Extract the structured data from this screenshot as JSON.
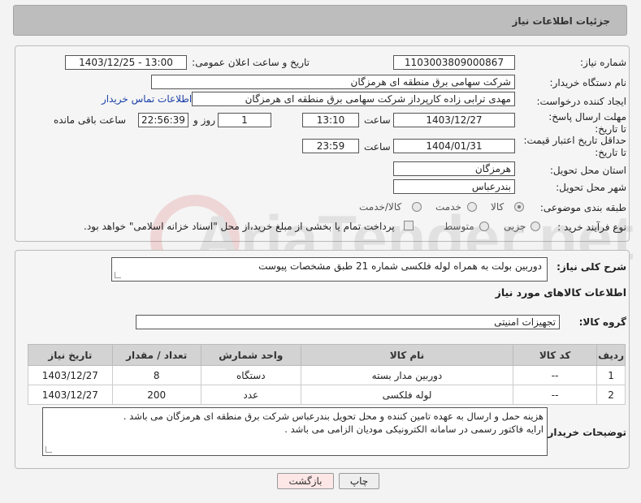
{
  "header": {
    "title": "جزئیات اطلاعات نیاز"
  },
  "form": {
    "need_number_label": "شماره نیاز:",
    "need_number": "1103003809000867",
    "announce_label": "تاریخ و ساعت اعلان عمومی:",
    "announce_value": "1403/12/25 - 13:00",
    "buyer_label": "نام دستگاه خریدار:",
    "buyer_value": "شرکت سهامی برق منطقه ای هرمزگان",
    "creator_label": "ایجاد کننده درخواست:",
    "creator_value": "مهدی ترابی زاده کارپرداز شرکت سهامی برق منطقه ای هرمزگان",
    "contact_link": "اطلاعات تماس خریدار",
    "deadline_label": "مهلت ارسال پاسخ: تا تاریخ:",
    "deadline_date": "1403/12/27",
    "time_label": "ساعت",
    "deadline_time": "13:10",
    "days_value": "1",
    "days_label": "روز و",
    "remaining_time": "22:56:39",
    "remaining_label": "ساعت باقی مانده",
    "validity_label": "حداقل تاریخ اعتبار قیمت: تا تاریخ:",
    "validity_date": "1404/01/31",
    "validity_time": "23:59",
    "province_label": "استان محل تحویل:",
    "province_value": "هرمزگان",
    "city_label": "شهر محل تحویل:",
    "city_value": "بندرعباس",
    "category_label": "طبقه بندی موضوعی:",
    "category_options": [
      "کالا",
      "خدمت",
      "کالا/خدمت"
    ],
    "category_selected": "کالا",
    "process_label": "نوع فرآیند خرید :",
    "process_options": [
      "جزیی",
      "متوسط"
    ],
    "payment_note": "پرداخت تمام یا بخشی از مبلغ خرید،از محل \"اسناد خزانه اسلامی\" خواهد بود."
  },
  "description": {
    "label": "شرح کلی نیاز:",
    "value": "دوربین بولت به همراه لوله فلکسی شماره 21 طبق مشخصات پیوست"
  },
  "goods": {
    "section_title": "اطلاعات کالاهای مورد نیاز",
    "group_label": "گروه کالا:",
    "group_value": "تجهیزات امنیتی",
    "columns": [
      "ردیف",
      "کد کالا",
      "نام کالا",
      "واحد شمارش",
      "تعداد / مقدار",
      "تاریخ نیاز"
    ],
    "rows": [
      [
        "1",
        "--",
        "دوربین مدار بسته",
        "دستگاه",
        "8",
        "1403/12/27"
      ],
      [
        "2",
        "--",
        "لوله فلکسی",
        "عدد",
        "200",
        "1403/12/27"
      ]
    ]
  },
  "buyer_notes": {
    "label": "توضیحات خریدار:",
    "line1": "هزینه حمل و ارسال به عهده تامین کننده و محل تحویل بندرعباس شرکت برق منطقه ای هرمزگان می باشد .",
    "line2": "ارایه فاکتور رسمی در سامانه الکترونیکی مودیان الزامی می باشد ."
  },
  "buttons": {
    "print": "چاپ",
    "back": "بازگشت"
  },
  "watermark": {
    "text": "AriaTender.net"
  }
}
